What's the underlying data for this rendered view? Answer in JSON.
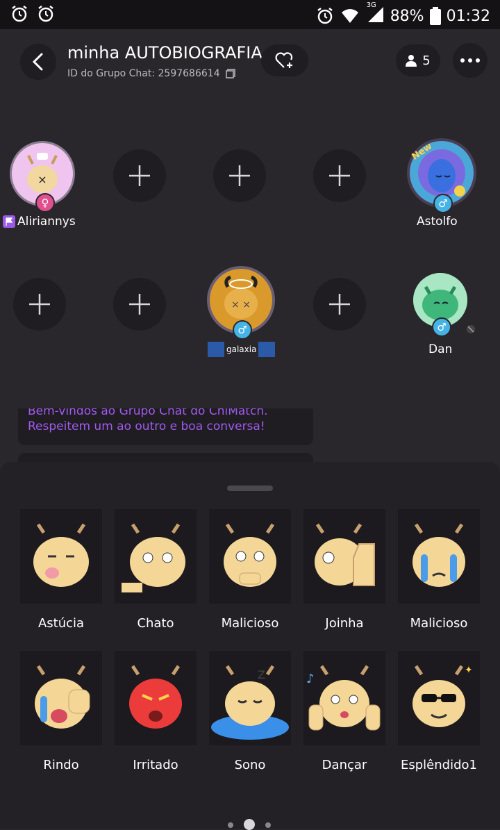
{
  "status_bar": {
    "battery": "88%",
    "time": "01:32",
    "network": "3G"
  },
  "header": {
    "title": "minha AUTOBIOGRAFIA",
    "subtitle": "ID do Grupo Chat: 2597686614",
    "members_count": "5"
  },
  "seats": {
    "user1": {
      "name": "Aliriannys"
    },
    "user2": {
      "name": "Astolfo",
      "badge": "New"
    },
    "user3": {
      "name": "galaxia"
    },
    "user4": {
      "name": "Dan"
    }
  },
  "messages": {
    "welcome_line1": "Bem-vindos ao Grupo Chat do ChiMatch.",
    "welcome_line2": "Respeitem um ao outro e boa conversa!"
  },
  "stickers": [
    {
      "label": "Astúcia",
      "icon": "deer-sly-icon"
    },
    {
      "label": "Chato",
      "icon": "deer-bored-icon"
    },
    {
      "label": "Malicioso",
      "icon": "deer-sneaky-icon"
    },
    {
      "label": "Joinha",
      "icon": "deer-thumbs-up-icon"
    },
    {
      "label": "Malicioso",
      "icon": "deer-crying-icon"
    },
    {
      "label": "Rindo",
      "icon": "deer-laughing-icon"
    },
    {
      "label": "Irritado",
      "icon": "deer-angry-icon"
    },
    {
      "label": "Sono",
      "icon": "deer-sleeping-icon"
    },
    {
      "label": "Dançar",
      "icon": "deer-dancing-icon"
    },
    {
      "label": "Esplêndido1",
      "icon": "deer-sunglasses-icon"
    }
  ],
  "colors": {
    "accent_purple": "#a15bf0",
    "male_badge": "#46b3e6",
    "female_badge": "#e24f8e"
  }
}
